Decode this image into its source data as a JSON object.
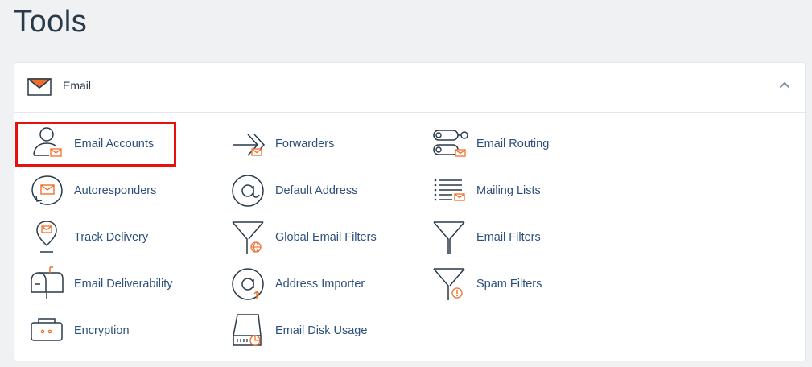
{
  "page": {
    "title": "Tools"
  },
  "section": {
    "title": "Email",
    "icon": "envelope-icon",
    "collapse_icon": "chevron-up-icon"
  },
  "items": [
    {
      "label": "Email Accounts",
      "icon": "email-accounts-icon"
    },
    {
      "label": "Forwarders",
      "icon": "forwarders-icon"
    },
    {
      "label": "Email Routing",
      "icon": "email-routing-icon"
    },
    {
      "label": "Autoresponders",
      "icon": "autoresponders-icon"
    },
    {
      "label": "Default Address",
      "icon": "default-address-icon"
    },
    {
      "label": "Mailing Lists",
      "icon": "mailing-lists-icon"
    },
    {
      "label": "Track Delivery",
      "icon": "track-delivery-icon"
    },
    {
      "label": "Global Email Filters",
      "icon": "global-email-filters-icon"
    },
    {
      "label": "Email Filters",
      "icon": "email-filters-icon"
    },
    {
      "label": "Email Deliverability",
      "icon": "email-deliverability-icon"
    },
    {
      "label": "Address Importer",
      "icon": "address-importer-icon"
    },
    {
      "label": "Spam Filters",
      "icon": "spam-filters-icon"
    },
    {
      "label": "Encryption",
      "icon": "encryption-icon"
    },
    {
      "label": "Email Disk Usage",
      "icon": "email-disk-usage-icon"
    }
  ],
  "colors": {
    "accent": "#f06e2c",
    "link": "#2d4f7c",
    "icon_stroke": "#293a4a",
    "highlight": "#e8100f"
  }
}
